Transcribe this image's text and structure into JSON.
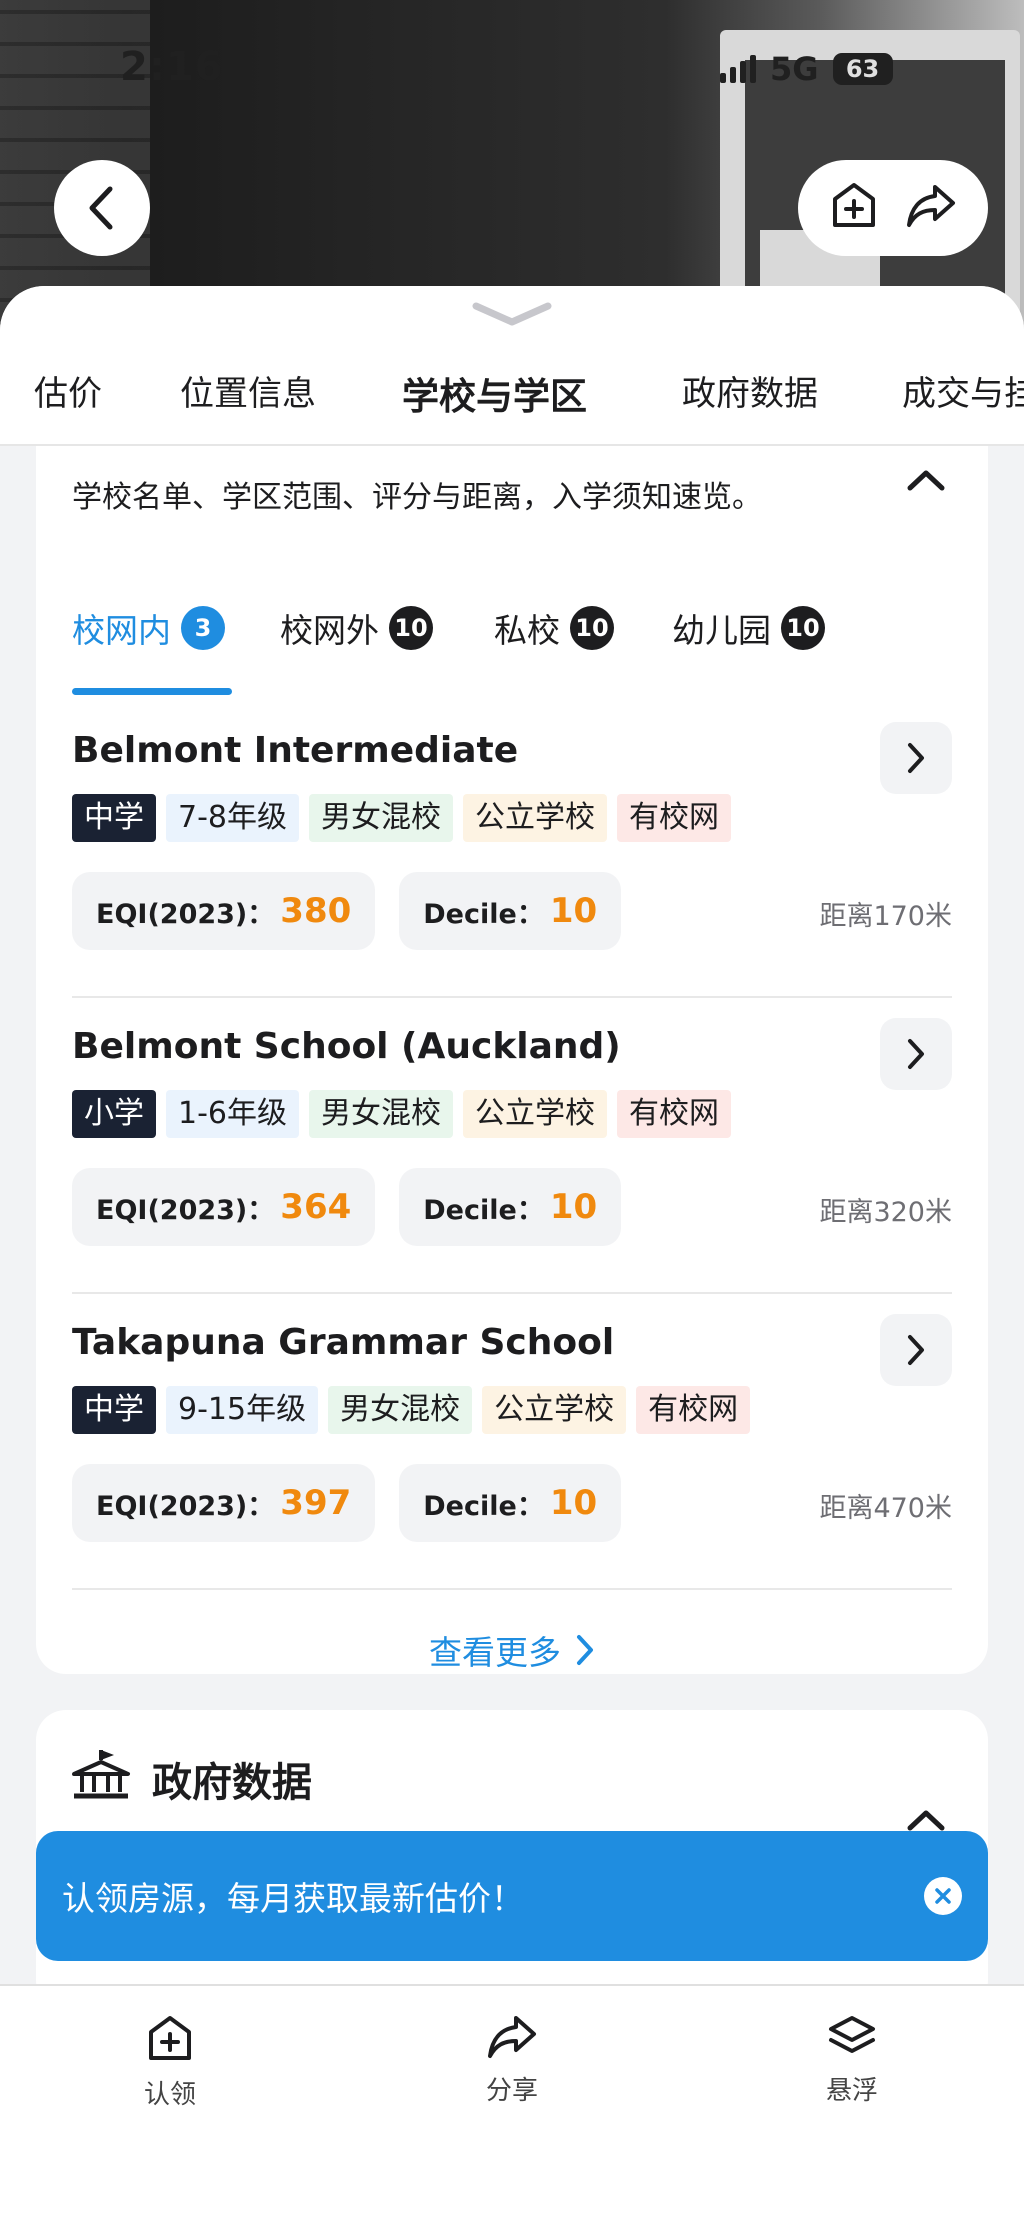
{
  "status_bar": {
    "time": "2:16",
    "network": "5G",
    "battery": "63"
  },
  "nav_tabs": [
    {
      "label": "估价"
    },
    {
      "label": "位置信息"
    },
    {
      "label": "学校与学区"
    },
    {
      "label": "政府数据"
    },
    {
      "label": "成交与挂"
    }
  ],
  "school_section": {
    "description": "学校名单、学区范围、评分与距离，入学须知速览。",
    "tabs": [
      {
        "label": "校网内",
        "count": "3"
      },
      {
        "label": "校网外",
        "count": "10"
      },
      {
        "label": "私校",
        "count": "10"
      },
      {
        "label": "幼儿园",
        "count": "10"
      }
    ],
    "schools": [
      {
        "name": "Belmont Intermediate",
        "level": "中学",
        "grades": "7-8年级",
        "gender": "男女混校",
        "type": "公立学校",
        "zone": "有校网",
        "eqi_label": "EQI(2023)：",
        "eqi": "380",
        "decile_label": "Decile：",
        "decile": "10",
        "distance": "距离170米"
      },
      {
        "name": "Belmont School (Auckland)",
        "level": "小学",
        "grades": "1-6年级",
        "gender": "男女混校",
        "type": "公立学校",
        "zone": "有校网",
        "eqi_label": "EQI(2023)：",
        "eqi": "364",
        "decile_label": "Decile：",
        "decile": "10",
        "distance": "距离320米"
      },
      {
        "name": "Takapuna Grammar School",
        "level": "中学",
        "grades": "9-15年级",
        "gender": "男女混校",
        "type": "公立学校",
        "zone": "有校网",
        "eqi_label": "EQI(2023)：",
        "eqi": "397",
        "decile_label": "Decile：",
        "decile": "10",
        "distance": "距离470米"
      }
    ],
    "more_label": "查看更多"
  },
  "gov_section": {
    "title": "政府数据"
  },
  "banner": {
    "text": "认领房源，每月获取最新估价！"
  },
  "bottom_bar": [
    {
      "label": "认领",
      "icon": "plus-square-icon"
    },
    {
      "label": "分享",
      "icon": "share-icon"
    },
    {
      "label": "悬浮",
      "icon": "layers-icon"
    }
  ],
  "colors": {
    "accent": "#1f8de0",
    "score": "#f0890e",
    "level_tag": "#1a2233"
  }
}
